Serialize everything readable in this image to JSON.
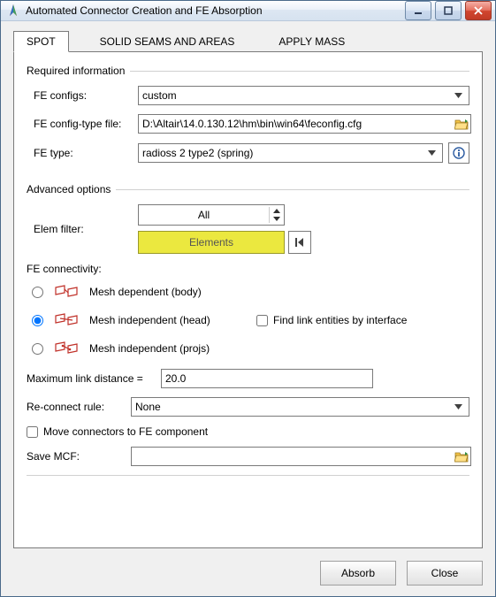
{
  "window": {
    "title": "Automated Connector Creation and FE Absorption"
  },
  "tabs": [
    {
      "label": "SPOT",
      "active": true
    },
    {
      "label": "SOLID SEAMS AND AREAS",
      "active": false
    },
    {
      "label": "APPLY MASS",
      "active": false
    }
  ],
  "required": {
    "legend": "Required information",
    "fe_configs_label": "FE configs:",
    "fe_configs_value": "custom",
    "fe_config_file_label": "FE config-type file:",
    "fe_config_file_value": "D:\\Altair\\14.0.130.12\\hm\\bin\\win64\\feconfig.cfg",
    "fe_type_label": "FE type:",
    "fe_type_value": "radioss 2 type2 (spring)"
  },
  "advanced": {
    "legend": "Advanced options",
    "elem_filter_label": "Elem filter:",
    "elem_filter_value": "All",
    "elements_label": "Elements",
    "fe_connectivity_label": "FE connectivity:",
    "options": [
      {
        "label": "Mesh dependent (body)",
        "selected": false
      },
      {
        "label": "Mesh independent (head)",
        "selected": true
      },
      {
        "label": "Mesh independent (projs)",
        "selected": false
      }
    ],
    "find_link_label": "Find link entities by interface",
    "find_link_checked": false,
    "max_link_label": "Maximum link distance =",
    "max_link_value": "20.0",
    "reconnect_label": "Re-connect rule:",
    "reconnect_value": "None",
    "move_connectors_label": "Move connectors to FE component",
    "move_connectors_checked": false,
    "save_mcf_label": "Save MCF:",
    "save_mcf_value": ""
  },
  "buttons": {
    "absorb": "Absorb",
    "close": "Close"
  }
}
